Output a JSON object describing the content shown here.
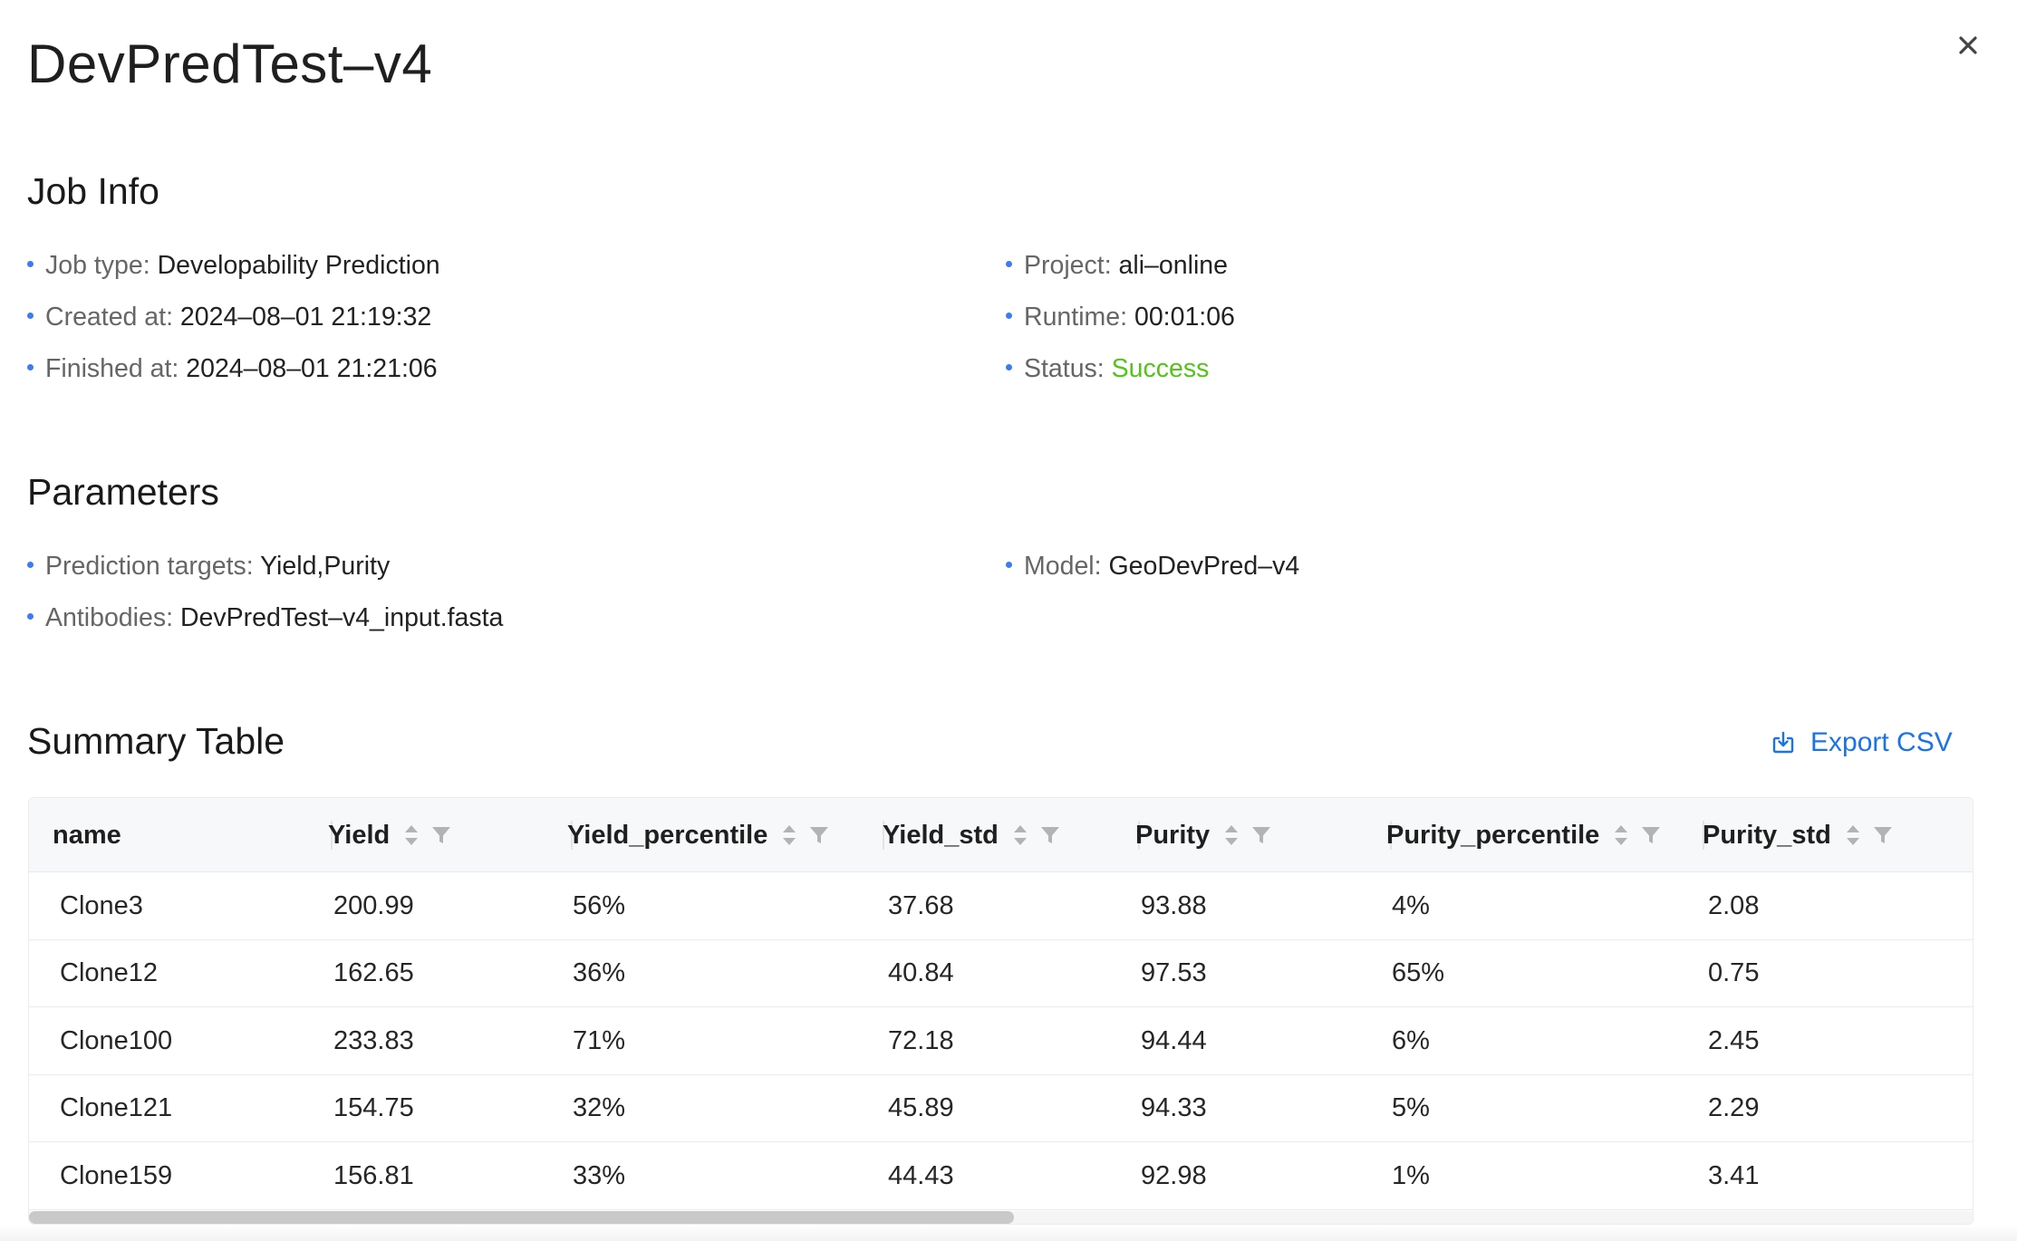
{
  "dialog": {
    "title": "DevPredTest–v4"
  },
  "job_info": {
    "heading": "Job Info",
    "left": [
      {
        "label": "Job type: ",
        "value": "Developability Prediction"
      },
      {
        "label": "Created at: ",
        "value": "2024–08–01 21:19:32"
      },
      {
        "label": "Finished at: ",
        "value": "2024–08–01 21:21:06"
      }
    ],
    "right": [
      {
        "label": "Project: ",
        "value": "ali–online"
      },
      {
        "label": "Runtime: ",
        "value": "00:01:06"
      },
      {
        "label": "Status: ",
        "value": "Success"
      }
    ]
  },
  "parameters": {
    "heading": "Parameters",
    "left": [
      {
        "label": "Prediction targets: ",
        "value": "Yield,Purity"
      },
      {
        "label": "Antibodies: ",
        "value": "DevPredTest–v4_input.fasta"
      }
    ],
    "right": [
      {
        "label": "Model: ",
        "value": "GeoDevPred–v4"
      }
    ]
  },
  "summary": {
    "heading": "Summary Table",
    "export_label": "Export CSV",
    "columns": [
      "name",
      "Yield",
      "Yield_percentile",
      "Yield_std",
      "Purity",
      "Purity_percentile",
      "Purity_std"
    ],
    "rows": [
      [
        "Clone3",
        "200.99",
        "56%",
        "37.68",
        "93.88",
        "4%",
        "2.08"
      ],
      [
        "Clone12",
        "162.65",
        "36%",
        "40.84",
        "97.53",
        "65%",
        "0.75"
      ],
      [
        "Clone100",
        "233.83",
        "71%",
        "72.18",
        "94.44",
        "6%",
        "2.45"
      ],
      [
        "Clone121",
        "154.75",
        "32%",
        "45.89",
        "94.33",
        "5%",
        "2.29"
      ],
      [
        "Clone159",
        "156.81",
        "33%",
        "44.43",
        "92.98",
        "1%",
        "3.41"
      ]
    ]
  },
  "colors": {
    "accent": "#3d7bf5",
    "link": "#1a73e8",
    "success": "#52c41a"
  },
  "icons": {
    "close": "close-icon",
    "export": "download-icon",
    "sort": "sort-icon",
    "filter": "filter-icon"
  }
}
